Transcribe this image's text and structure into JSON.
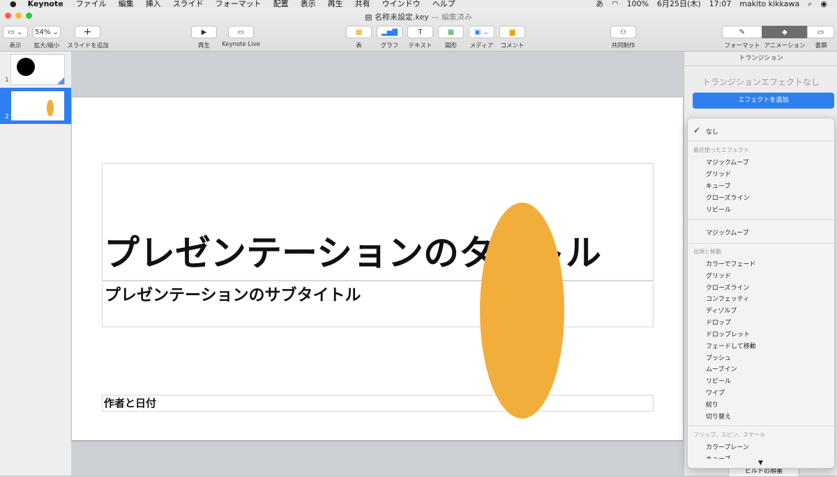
{
  "menubar": {
    "app_name": "Keynote",
    "items": [
      "ファイル",
      "編集",
      "挿入",
      "スライド",
      "フォーマット",
      "配置",
      "表示",
      "再生",
      "共有",
      "ウインドウ",
      "ヘルプ"
    ],
    "status_battery": "100%",
    "status_input": "あ",
    "status_date": "6月25日(木)",
    "status_time": "17:07",
    "status_user": "makito kikkawa"
  },
  "window": {
    "title": "名称未設定.key",
    "edited": "— 編集済み"
  },
  "toolbar": {
    "view_label": "表示",
    "zoom_value": "54%",
    "zoom_label": "拡大/縮小",
    "add_slide_label": "スライドを追加",
    "play_label": "再生",
    "keynote_live_label": "Keynote Live",
    "table_label": "表",
    "chart_label": "グラフ",
    "text_label": "テキスト",
    "shape_label": "図形",
    "media_label": "メディア",
    "comment_label": "コメント",
    "collaborate_label": "共同制作",
    "format_label": "フォーマット",
    "animate_label": "アニメーション",
    "document_label": "書類"
  },
  "sidebar": {
    "slides": [
      {
        "number": "1"
      },
      {
        "number": "2"
      }
    ]
  },
  "slide": {
    "title": "プレゼンテーションのタイトル",
    "subtitle": "プレゼンテーションのサブタイトル",
    "author": "作者と日付",
    "shape_color": "#f2ae3a"
  },
  "panel": {
    "tab": "トランジション",
    "no_effect": "トランジションエフェクトなし",
    "add_effect_button": "エフェクトを追加",
    "build_order_button": "ビルドの順番"
  },
  "effect_menu": {
    "selected": "なし",
    "recent_header": "最近使ったエフェクト",
    "recent_items": [
      "マジックムーブ",
      "グリッド",
      "キューブ",
      "クローズライン",
      "リビール"
    ],
    "magic_move": "マジックムーブ",
    "appear_header": "出現と移動",
    "appear_items": [
      "カラーでフェード",
      "グリッド",
      "クローズライン",
      "コンフェッティ",
      "ディゾルブ",
      "ドロップ",
      "ドロップレット",
      "フェードして移動",
      "プッシュ",
      "ムーブイン",
      "リビール",
      "ワイプ",
      "絞り",
      "切り替え"
    ],
    "flip_header": "フリップ、スピン、スケール",
    "flip_items": [
      "カラープレーン",
      "キューブ"
    ]
  },
  "colors": {
    "accent_blue": "#2f7ff0",
    "shape_orange": "#f2ae3a"
  }
}
